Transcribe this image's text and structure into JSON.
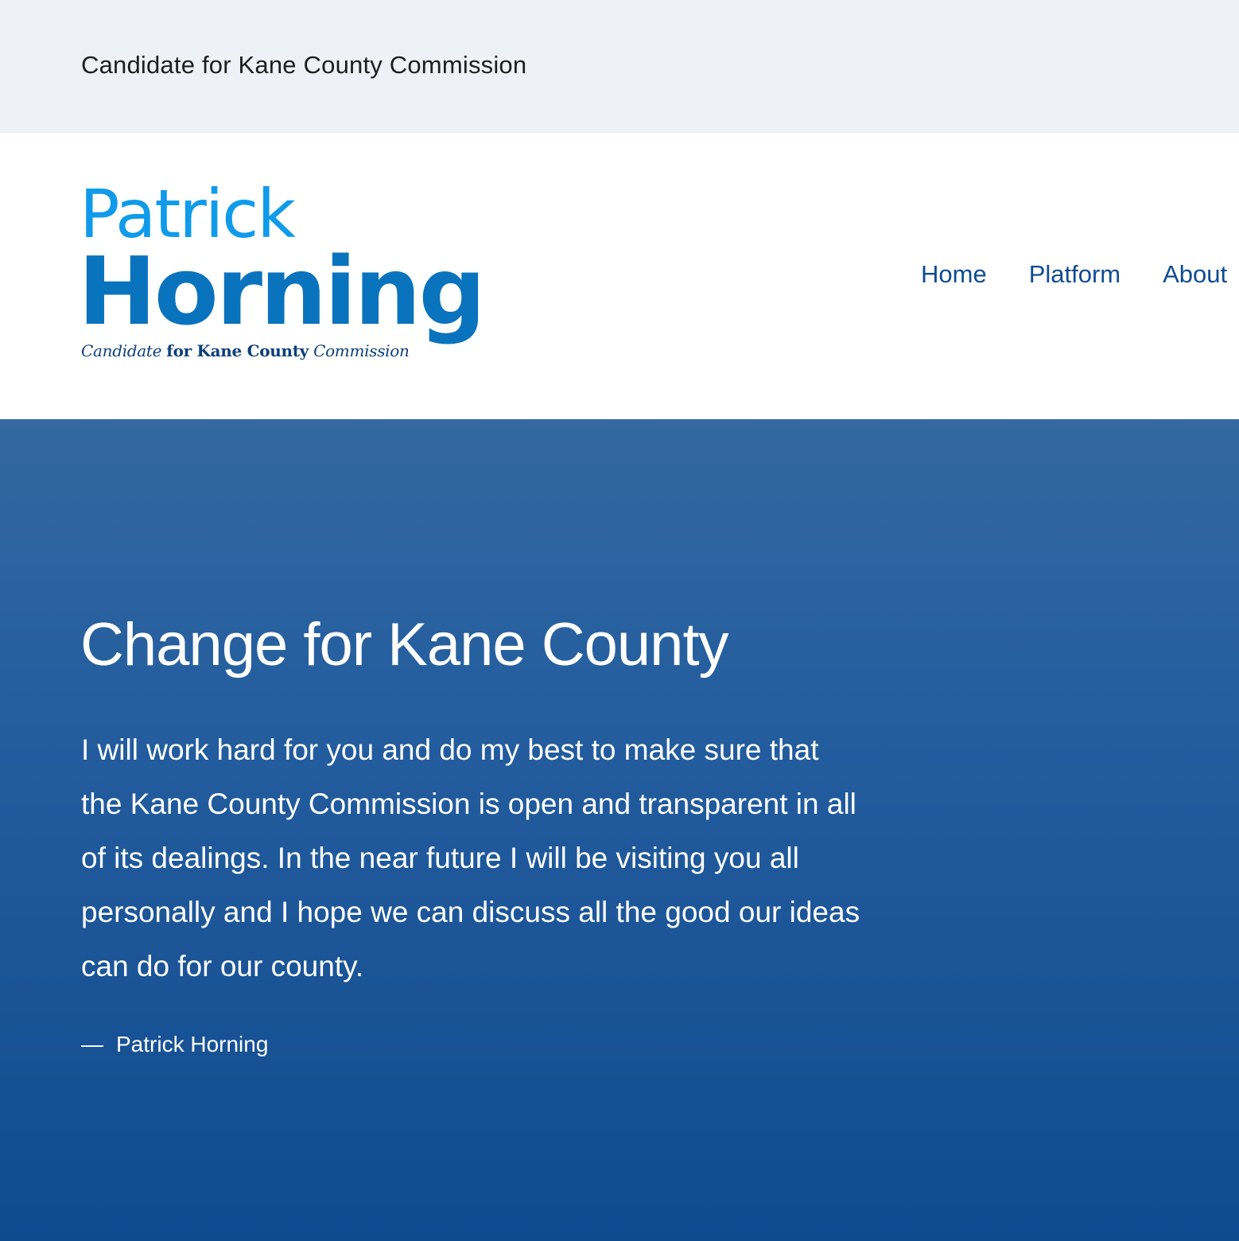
{
  "topbar": {
    "text": "Candidate for Kane County Commission"
  },
  "logo": {
    "first_name": "Patrick",
    "last_name": "Horning",
    "tagline_candidate": "Candidate",
    "tagline_for": "for Kane County",
    "tagline_commission": "Commission"
  },
  "nav": {
    "items": [
      {
        "label": "Home"
      },
      {
        "label": "Platform"
      },
      {
        "label": "About"
      }
    ]
  },
  "hero": {
    "title": "Change for Kane County",
    "body_lines": [
      "I will work hard for you and do my best to make sure that",
      "the Kane County Commission is open and transparent in all",
      "of its dealings. In the near future I will be visiting you all",
      "personally and I hope we can discuss all the good our ideas",
      "can do for our county."
    ],
    "citation_dash": "—",
    "citation": "Patrick Horning"
  },
  "colors": {
    "topbar_bg": "#eef1f5",
    "logo_first": "#0f9bea",
    "logo_last": "#0a73bd",
    "nav_link": "#0f4c92",
    "hero_top": "#3368a0",
    "hero_bottom": "#0f4a8f"
  }
}
